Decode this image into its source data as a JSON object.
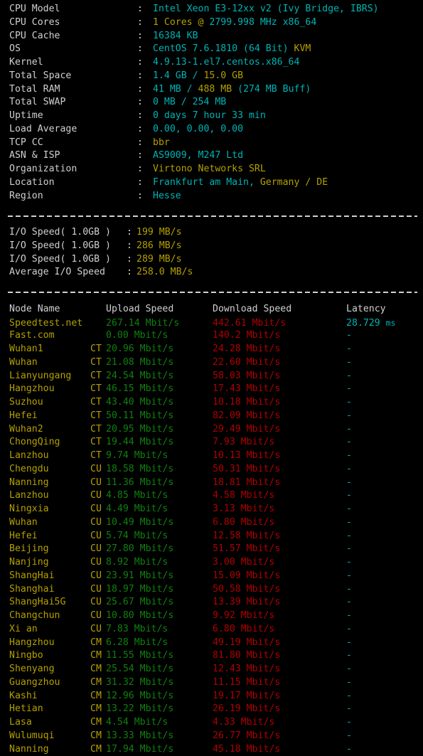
{
  "system_info": {
    "rows": [
      {
        "label": "CPU Model",
        "segments": [
          {
            "text": "Intel Xeon E3-12xx v2 (Ivy Bridge, IBRS)",
            "color": "cyan"
          }
        ]
      },
      {
        "label": "CPU Cores",
        "segments": [
          {
            "text": "1 Cores @ ",
            "color": "yellow"
          },
          {
            "text": "2799.998 MHz x86_64",
            "color": "cyan"
          }
        ]
      },
      {
        "label": "CPU Cache",
        "segments": [
          {
            "text": "16384 KB",
            "color": "cyan"
          }
        ]
      },
      {
        "label": "OS",
        "segments": [
          {
            "text": "CentOS 7.6.1810 (64 Bit) ",
            "color": "cyan"
          },
          {
            "text": "KVM",
            "color": "yellow"
          }
        ]
      },
      {
        "label": "Kernel",
        "segments": [
          {
            "text": "4.9.13-1.el7.centos.x86_64",
            "color": "cyan"
          }
        ]
      },
      {
        "label": "Total Space",
        "segments": [
          {
            "text": "1.4 GB / ",
            "color": "cyan"
          },
          {
            "text": "15.0 GB",
            "color": "yellow"
          }
        ]
      },
      {
        "label": "Total RAM",
        "segments": [
          {
            "text": "41 MB / ",
            "color": "cyan"
          },
          {
            "text": "488 MB",
            "color": "yellow"
          },
          {
            "text": " (274 MB Buff)",
            "color": "cyan"
          }
        ]
      },
      {
        "label": "Total SWAP",
        "segments": [
          {
            "text": "0 MB / 254 MB",
            "color": "cyan"
          }
        ]
      },
      {
        "label": "Uptime",
        "segments": [
          {
            "text": "0 days 7 hour 33 min",
            "color": "cyan"
          }
        ]
      },
      {
        "label": "Load Average",
        "segments": [
          {
            "text": "0.00, 0.00, 0.00",
            "color": "cyan"
          }
        ]
      },
      {
        "label": "TCP CC",
        "segments": [
          {
            "text": "bbr",
            "color": "yellow"
          }
        ]
      },
      {
        "label": "ASN & ISP",
        "segments": [
          {
            "text": "AS9009, M247 Ltd",
            "color": "cyan"
          }
        ]
      },
      {
        "label": "Organization",
        "segments": [
          {
            "text": "Virtono Networks SRL",
            "color": "yellow"
          }
        ]
      },
      {
        "label": "Location",
        "segments": [
          {
            "text": "Frankfurt am Main, ",
            "color": "cyan"
          },
          {
            "text": "Germany / DE",
            "color": "yellow"
          }
        ]
      },
      {
        "label": "Region",
        "segments": [
          {
            "text": "Hesse",
            "color": "cyan"
          }
        ]
      }
    ]
  },
  "io_test": {
    "rows": [
      {
        "label": "I/O Speed( 1.0GB )",
        "value": "199 MB/s"
      },
      {
        "label": "I/O Speed( 1.0GB )",
        "value": "286 MB/s"
      },
      {
        "label": "I/O Speed( 1.0GB )",
        "value": "289 MB/s"
      },
      {
        "label": "Average I/O Speed",
        "value": "258.0 MB/s"
      }
    ]
  },
  "speedtest": {
    "headers": {
      "node": "Node Name",
      "isp": "",
      "upload": "Upload Speed",
      "download": "Download Speed",
      "latency": "Latency"
    },
    "rows": [
      {
        "node": "Speedtest.net",
        "isp": "",
        "upload": "267.14 Mbit/s",
        "download": "442.61 Mbit/s",
        "latency": "28.729 ms"
      },
      {
        "node": "Fast.com",
        "isp": "",
        "upload": "0.00 Mbit/s",
        "download": "140.2 Mbit/s",
        "latency": "-"
      },
      {
        "node": "Wuhan1",
        "isp": "CT",
        "upload": "20.96 Mbit/s",
        "download": "24.28 Mbit/s",
        "latency": "-"
      },
      {
        "node": "Wuhan",
        "isp": "CT",
        "upload": "21.08 Mbit/s",
        "download": "22.60 Mbit/s",
        "latency": "-"
      },
      {
        "node": "Lianyungang",
        "isp": "CT",
        "upload": "24.54 Mbit/s",
        "download": "58.03 Mbit/s",
        "latency": "-"
      },
      {
        "node": "Hangzhou",
        "isp": "CT",
        "upload": "46.15 Mbit/s",
        "download": "17.43 Mbit/s",
        "latency": "-"
      },
      {
        "node": "Suzhou",
        "isp": "CT",
        "upload": "43.40 Mbit/s",
        "download": "10.18 Mbit/s",
        "latency": "-"
      },
      {
        "node": "Hefei",
        "isp": "CT",
        "upload": "50.11 Mbit/s",
        "download": "82.09 Mbit/s",
        "latency": "-"
      },
      {
        "node": "Wuhan2",
        "isp": "CT",
        "upload": "20.95 Mbit/s",
        "download": "29.49 Mbit/s",
        "latency": "-"
      },
      {
        "node": "ChongQing",
        "isp": "CT",
        "upload": "19.44 Mbit/s",
        "download": "7.93 Mbit/s",
        "latency": "-"
      },
      {
        "node": "Lanzhou",
        "isp": "CT",
        "upload": "9.74 Mbit/s",
        "download": "10.13 Mbit/s",
        "latency": "-"
      },
      {
        "node": "Chengdu",
        "isp": "CU",
        "upload": "18.58 Mbit/s",
        "download": "50.31 Mbit/s",
        "latency": "-"
      },
      {
        "node": "Nanning",
        "isp": "CU",
        "upload": "11.36 Mbit/s",
        "download": "18.81 Mbit/s",
        "latency": "-"
      },
      {
        "node": "Lanzhou",
        "isp": "CU",
        "upload": "4.85 Mbit/s",
        "download": "4.58 Mbit/s",
        "latency": "-"
      },
      {
        "node": "Ningxia",
        "isp": "CU",
        "upload": "4.49 Mbit/s",
        "download": "3.13 Mbit/s",
        "latency": "-"
      },
      {
        "node": "Wuhan",
        "isp": "CU",
        "upload": "10.49 Mbit/s",
        "download": "6.80 Mbit/s",
        "latency": "-"
      },
      {
        "node": "Hefei",
        "isp": "CU",
        "upload": "5.74 Mbit/s",
        "download": "12.58 Mbit/s",
        "latency": "-"
      },
      {
        "node": "Beijing",
        "isp": "CU",
        "upload": "27.80 Mbit/s",
        "download": "51.57 Mbit/s",
        "latency": "-"
      },
      {
        "node": "Nanjing",
        "isp": "CU",
        "upload": "8.92 Mbit/s",
        "download": "3.00 Mbit/s",
        "latency": "-"
      },
      {
        "node": "ShangHai",
        "isp": "CU",
        "upload": "23.91 Mbit/s",
        "download": "15.09 Mbit/s",
        "latency": "-"
      },
      {
        "node": "Shanghai",
        "isp": "CU",
        "upload": "18.97 Mbit/s",
        "download": "50.58 Mbit/s",
        "latency": "-"
      },
      {
        "node": "ShangHai5G",
        "isp": "CU",
        "upload": "25.67 Mbit/s",
        "download": "13.39 Mbit/s",
        "latency": "-"
      },
      {
        "node": "Changchun",
        "isp": "CU",
        "upload": "10.80 Mbit/s",
        "download": "9.92 Mbit/s",
        "latency": "-"
      },
      {
        "node": "Xi an",
        "isp": "CU",
        "upload": "7.83 Mbit/s",
        "download": "6.80 Mbit/s",
        "latency": "-"
      },
      {
        "node": "Hangzhou",
        "isp": "CM",
        "upload": "6.28 Mbit/s",
        "download": "49.19 Mbit/s",
        "latency": "-"
      },
      {
        "node": "Ningbo",
        "isp": "CM",
        "upload": "11.55 Mbit/s",
        "download": "81.80 Mbit/s",
        "latency": "-"
      },
      {
        "node": "Shenyang",
        "isp": "CM",
        "upload": "25.54 Mbit/s",
        "download": "12.43 Mbit/s",
        "latency": "-"
      },
      {
        "node": "Guangzhou",
        "isp": "CM",
        "upload": "31.32 Mbit/s",
        "download": "11.15 Mbit/s",
        "latency": "-"
      },
      {
        "node": "Kashi",
        "isp": "CM",
        "upload": "12.96 Mbit/s",
        "download": "19.17 Mbit/s",
        "latency": "-"
      },
      {
        "node": "Hetian",
        "isp": "CM",
        "upload": "13.22 Mbit/s",
        "download": "26.19 Mbit/s",
        "latency": "-"
      },
      {
        "node": "Lasa",
        "isp": "CM",
        "upload": "4.54 Mbit/s",
        "download": "4.33 Mbit/s",
        "latency": "-"
      },
      {
        "node": "Wulumuqi",
        "isp": "CM",
        "upload": "13.33 Mbit/s",
        "download": "26.77 Mbit/s",
        "latency": "-"
      },
      {
        "node": "Nanning",
        "isp": "CM",
        "upload": "17.94 Mbit/s",
        "download": "45.18 Mbit/s",
        "latency": "-"
      }
    ]
  },
  "colors": {
    "background": "#000000",
    "label": "#d0d0d0",
    "cyan": "#00b3b3",
    "yellow": "#b3a000",
    "green": "#108010",
    "red": "#b00000"
  }
}
